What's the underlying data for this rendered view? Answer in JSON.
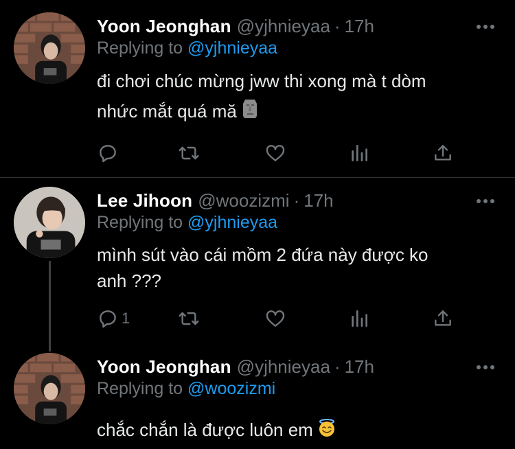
{
  "tweets": [
    {
      "name": "Yoon Jeonghan",
      "handle": "@yjhnieyaa",
      "dot": "·",
      "time": "17h",
      "replying_prefix": "Replying to",
      "replying_to": "@yjhnieyaa",
      "text_line1": "đi chơi chúc mừng jww thi xong mà t dòm",
      "text_line2": "nhức mắt quá mă",
      "emoji": "moai",
      "reply_count": "",
      "icons": [
        "reply-icon",
        "retweet-icon",
        "like-icon",
        "analytics-icon",
        "share-icon",
        "more-icon"
      ]
    },
    {
      "name": "Lee Jihoon",
      "handle": "@woozizmi",
      "dot": "·",
      "time": "17h",
      "replying_prefix": "Replying to",
      "replying_to": "@yjhnieyaa",
      "text_line1": "mình sút vào cái mồm 2 đứa này được ko",
      "text_line2": "anh ???",
      "reply_count": "1",
      "icons": [
        "reply-icon",
        "retweet-icon",
        "like-icon",
        "analytics-icon",
        "share-icon",
        "more-icon"
      ]
    },
    {
      "name": "Yoon Jeonghan",
      "handle": "@yjhnieyaa",
      "dot": "·",
      "time": "17h",
      "replying_prefix": "Replying to",
      "replying_to": "@woozizmi",
      "text_line1": "chắc chắn là được luôn em",
      "emoji": "smiling-face-with-halo"
    }
  ],
  "colors": {
    "background": "#000000",
    "primary_text": "#e7e9ea",
    "secondary_text": "#71767b",
    "mention": "#1d9bf0",
    "divider": "#2f3336"
  }
}
